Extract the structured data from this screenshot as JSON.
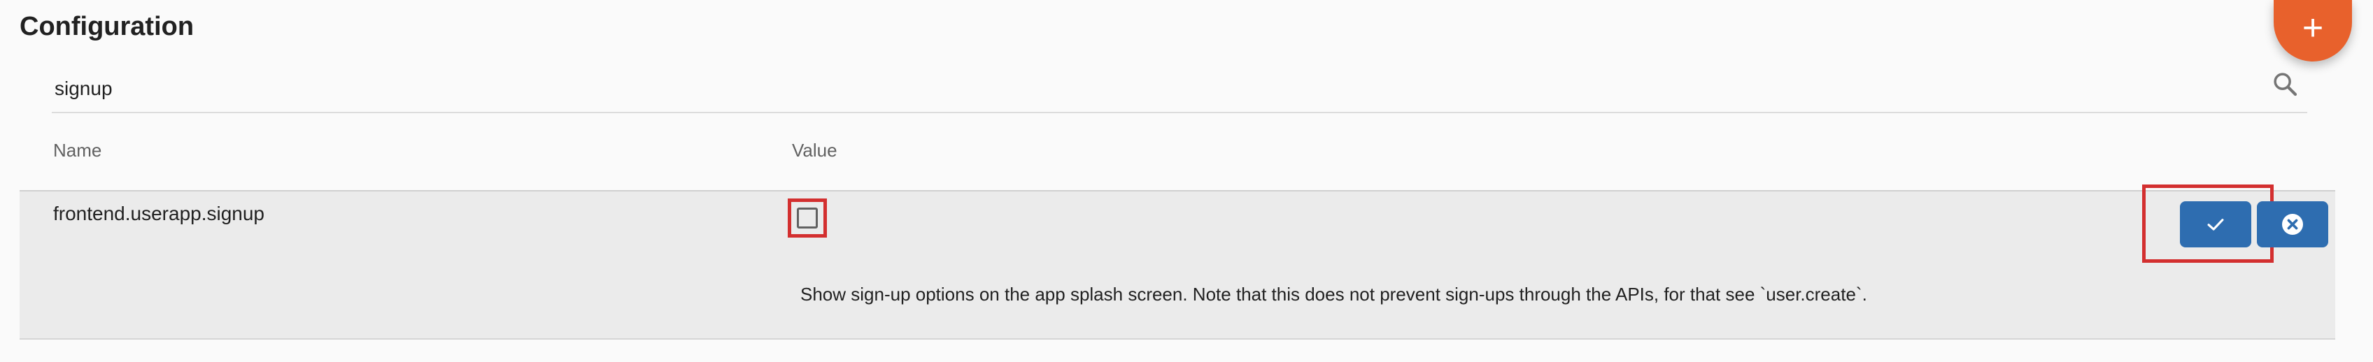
{
  "page": {
    "title": "Configuration"
  },
  "fab": {
    "glyph": "+",
    "icon": "plus-icon",
    "color": "#e8612c"
  },
  "search": {
    "value": "signup",
    "icon": "search-icon"
  },
  "table": {
    "columns": [
      "Name",
      "Value"
    ],
    "rows": [
      {
        "name": "frontend.userapp.signup",
        "checked": false,
        "description": "Show sign-up options on the app splash screen. Note that this does not prevent sign-ups through the APIs, for that see `user.create`."
      }
    ]
  },
  "actions": {
    "confirm_icon": "check-icon",
    "cancel_icon": "close-circle-icon",
    "button_color": "#2e6db0"
  },
  "highlight": {
    "color": "#d32f2f"
  }
}
